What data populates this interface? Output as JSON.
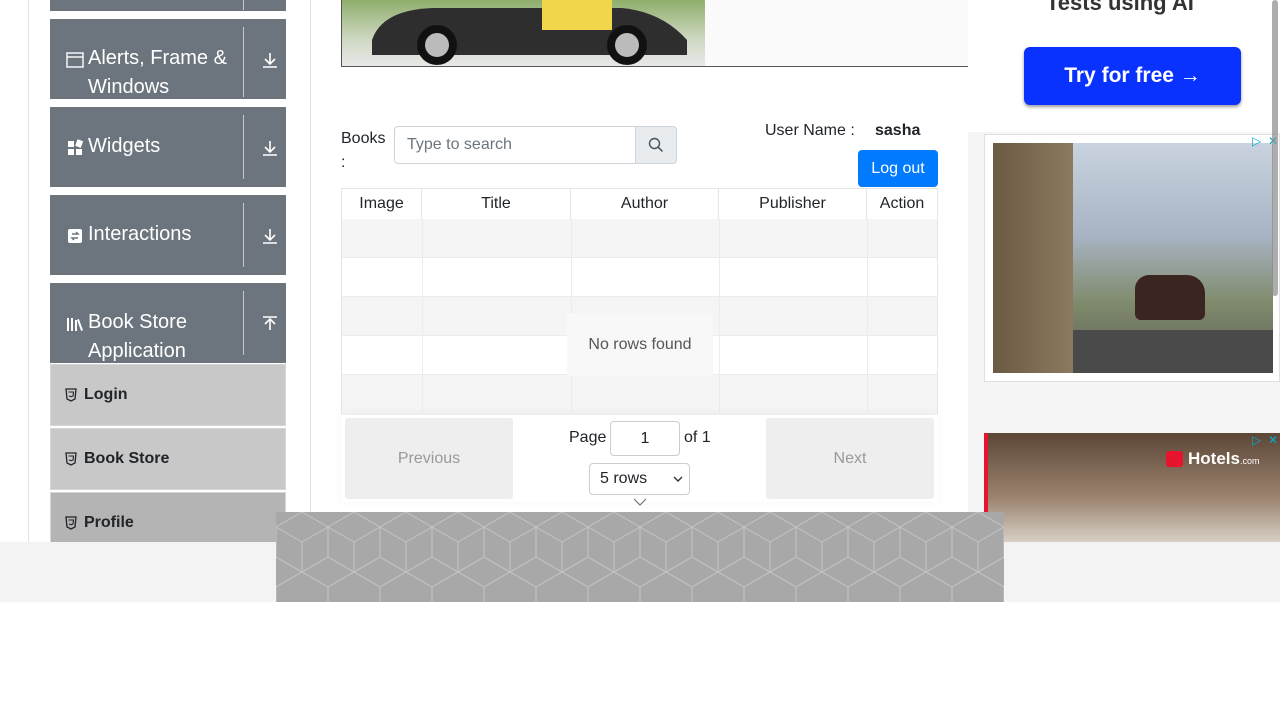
{
  "sidebar": {
    "groups": [
      {
        "label": "Alerts, Frame & Windows",
        "icon": "window-icon",
        "arrow": "download-arrow-icon"
      },
      {
        "label": "Widgets",
        "icon": "widgets-icon",
        "arrow": "download-arrow-icon"
      },
      {
        "label": "Interactions",
        "icon": "interactions-icon",
        "arrow": "download-arrow-icon"
      },
      {
        "label": "Book Store Application",
        "icon": "books-icon",
        "arrow": "upload-arrow-icon"
      }
    ],
    "sub_items": [
      {
        "label": "Login",
        "icon": "html5-icon"
      },
      {
        "label": "Book Store",
        "icon": "html5-icon"
      },
      {
        "label": "Profile",
        "icon": "html5-icon"
      }
    ]
  },
  "profile": {
    "books_label": "Books :",
    "search_placeholder": "Type to search",
    "user_name_label": "User Name :",
    "user_name_value": "sasha",
    "logout_label": "Log out"
  },
  "table": {
    "columns": [
      "Image",
      "Title",
      "Author",
      "Publisher",
      "Action"
    ],
    "empty_message": "No rows found",
    "pagination": {
      "previous_label": "Previous",
      "next_label": "Next",
      "page_label": "Page",
      "current_page": "1",
      "of_label": "of 1",
      "rows_option": "5 rows"
    }
  },
  "ads": {
    "top_text": "Tests using AI",
    "try_label": "Try for free →",
    "hotels_label": "Hotels",
    "hotels_suffix": ".com",
    "adchoice_marker": "▷",
    "close_marker": "✕"
  },
  "colors": {
    "sidebar_group": "#6c757d",
    "sub_item": "#c8c8c8",
    "primary": "#007bff",
    "try_button": "#0a32ff",
    "hotels_red": "#e8132d"
  }
}
